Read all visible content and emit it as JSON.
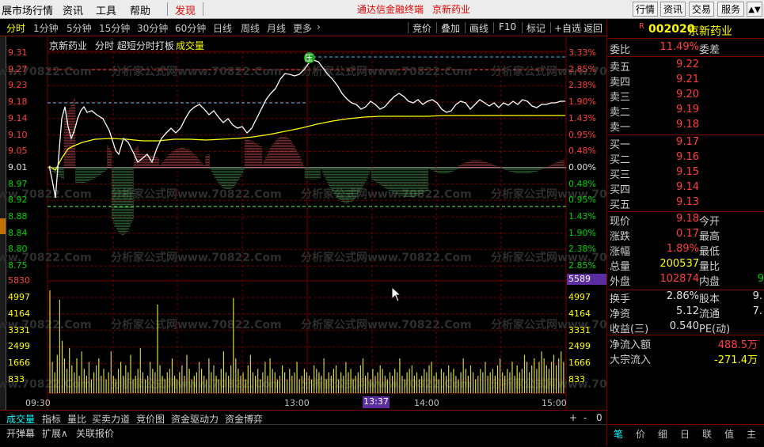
{
  "menubar": {
    "items": [
      "展市场行情",
      "资讯",
      "工具",
      "帮助",
      "发现"
    ],
    "center_text": "通达信金融终端",
    "center_stock": "京新药业",
    "right_buttons": [
      "行情",
      "资讯",
      "交易",
      "服务"
    ]
  },
  "tabbar": {
    "periods": [
      "分时",
      "1分钟",
      "5分钟",
      "15分钟",
      "30分钟",
      "60分钟",
      "日线",
      "周线",
      "月线",
      "更多"
    ],
    "active_index": 0,
    "tools": [
      "竞价",
      "叠加",
      "画线",
      "F10",
      "标记",
      "+自选",
      "返回"
    ]
  },
  "chart": {
    "title_name": "京新药业",
    "title_rest": "分时 超短分时打板",
    "title_volume": "成交量",
    "price_labels": [
      "9.31",
      "9.27",
      "9.23",
      "9.18",
      "9.14",
      "9.10",
      "9.05",
      "9.01",
      "8.97",
      "8.92",
      "8.88",
      "8.84",
      "8.80",
      "8.75"
    ],
    "pct_labels": [
      "3.33%",
      "2.85%",
      "2.38%",
      "1.90%",
      "1.43%",
      "0.95%",
      "0.48%",
      "0.00%",
      "0.48%",
      "0.95%",
      "1.43%",
      "1.90%",
      "2.38%",
      "2.85%"
    ],
    "volume_max_label": "5830",
    "volume_max_right": "5589",
    "volume_labels": [
      "4997",
      "4164",
      "3331",
      "2499",
      "1666",
      "833"
    ],
    "time_labels": [
      "09:30",
      "13:00",
      "14:00",
      "15:00"
    ],
    "cursor_time": "13:37",
    "pressure_badge": "压",
    "watermark": "分析家公式网www.70822.Com",
    "colors": {
      "up": "#ff4040",
      "down": "#00d400",
      "price_line": "#ffffff",
      "avg_line": "#ffff00",
      "grid": "#7a0000"
    }
  },
  "panel": {
    "code_marker": "R",
    "code": "002020",
    "name": "京新药业",
    "weibi_label": "委比",
    "weibi_value": "11.49%",
    "weicha_label": "委差",
    "sells": [
      {
        "label": "卖五",
        "price": "9.22"
      },
      {
        "label": "卖四",
        "price": "9.21"
      },
      {
        "label": "卖三",
        "price": "9.20"
      },
      {
        "label": "卖二",
        "price": "9.19"
      },
      {
        "label": "卖一",
        "price": "9.18"
      }
    ],
    "buys": [
      {
        "label": "买一",
        "price": "9.17"
      },
      {
        "label": "买二",
        "price": "9.16"
      },
      {
        "label": "买三",
        "price": "9.15"
      },
      {
        "label": "买四",
        "price": "9.14"
      },
      {
        "label": "买五",
        "price": "9.13"
      }
    ],
    "stats": [
      {
        "k": "现价",
        "v": "9.18",
        "vc": "red",
        "k2": "今开",
        "v2": ""
      },
      {
        "k": "涨跌",
        "v": "0.17",
        "vc": "red",
        "k2": "最高",
        "v2": ""
      },
      {
        "k": "涨幅",
        "v": "1.89%",
        "vc": "red",
        "k2": "最低",
        "v2": ""
      },
      {
        "k": "总量",
        "v": "200537",
        "vc": "yellow",
        "k2": "量比",
        "v2": ""
      },
      {
        "k": "外盘",
        "v": "102874",
        "vc": "red",
        "k2": "内盘",
        "v2": "9"
      }
    ],
    "stats2": [
      {
        "k": "换手",
        "v": "2.86%",
        "vc": "white",
        "k2": "股本",
        "v2": "9."
      },
      {
        "k": "净资",
        "v": "5.12",
        "vc": "white",
        "k2": "流通",
        "v2": "7."
      },
      {
        "k": "收益(三)",
        "v": "0.540",
        "vc": "white",
        "k2": "PE(动)",
        "v2": ""
      }
    ],
    "flows": [
      {
        "k": "净流入额",
        "v": "488.5万",
        "vc": "red"
      },
      {
        "k": "大宗流入",
        "v": "-271.4万",
        "vc": "yellow"
      }
    ],
    "bottom_tabs": [
      "笔",
      "价",
      "细",
      "日",
      "联",
      "值",
      "主"
    ]
  },
  "bottombar": {
    "tabs": [
      "成交量",
      "指标",
      "量比",
      "买卖力道",
      "竞价图",
      "资金驱动力",
      "资金博弈"
    ],
    "controls": [
      "+",
      "-",
      "0"
    ],
    "row2": [
      "开弹幕",
      "扩展∧",
      "关联报价"
    ]
  }
}
